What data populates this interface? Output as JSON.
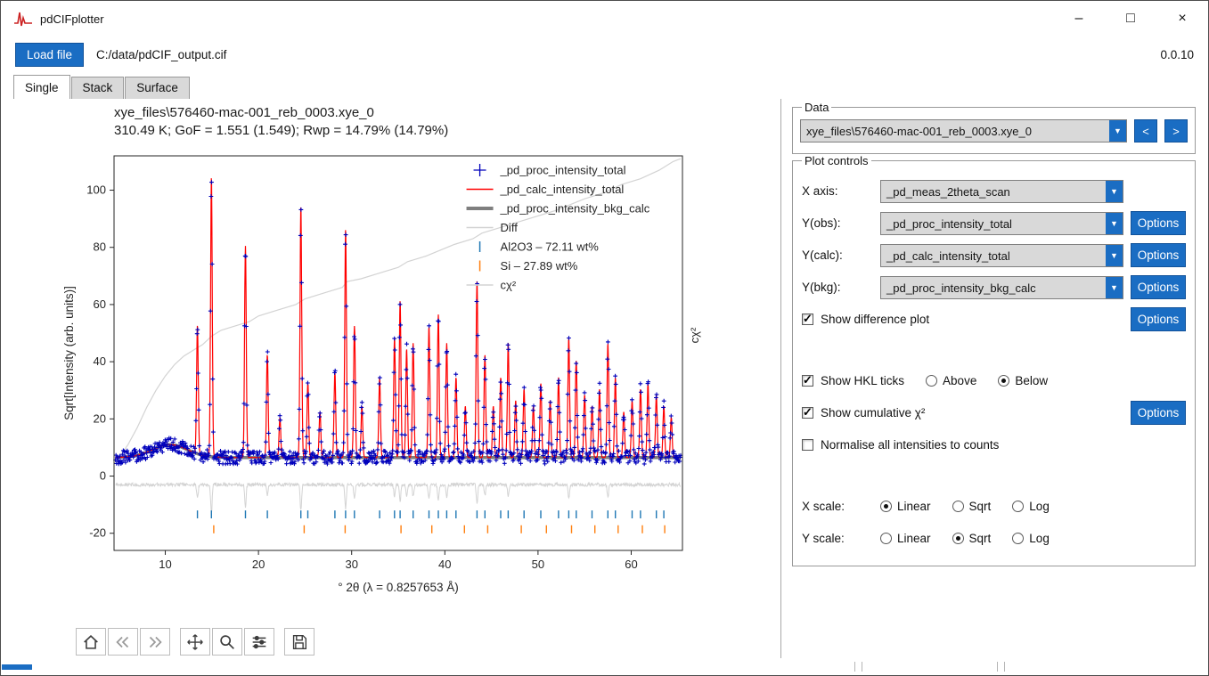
{
  "window": {
    "title": "pdCIFplotter",
    "controls": {
      "minimize": "–",
      "maximize": "□",
      "close": "×"
    }
  },
  "icons": {
    "dropdown": "▼"
  },
  "toolbar": {
    "load_file_label": "Load file",
    "file_path": "C:/data/pdCIF_output.cif",
    "version": "0.0.10"
  },
  "tabs": [
    {
      "label": "Single",
      "active": true
    },
    {
      "label": "Stack",
      "active": false
    },
    {
      "label": "Surface",
      "active": false
    }
  ],
  "data_section": {
    "label": "Data",
    "file_combo_value": "xye_files\\576460-mac-001_reb_0003.xye_0",
    "prev_label": "<",
    "next_label": ">"
  },
  "plot_controls": {
    "label": "Plot controls",
    "x_axis": {
      "label": "X axis:",
      "value": "_pd_meas_2theta_scan"
    },
    "y_obs": {
      "label": "Y(obs):",
      "value": "_pd_proc_intensity_total",
      "options_label": "Options"
    },
    "y_calc": {
      "label": "Y(calc):",
      "value": "_pd_calc_intensity_total",
      "options_label": "Options"
    },
    "y_bkg": {
      "label": "Y(bkg):",
      "value": "_pd_proc_intensity_bkg_calc",
      "options_label": "Options"
    },
    "show_difference": {
      "label": "Show difference plot",
      "checked": true,
      "options_label": "Options"
    },
    "show_hkl": {
      "label": "Show HKL ticks",
      "checked": true,
      "above_label": "Above",
      "below_label": "Below",
      "position": "Below"
    },
    "show_cumchi": {
      "label": "Show cumulative χ²",
      "checked": true,
      "options_label": "Options"
    },
    "normalise": {
      "label": "Normalise all intensities to counts",
      "checked": false
    },
    "x_scale": {
      "label": "X scale:",
      "options": [
        "Linear",
        "Sqrt",
        "Log"
      ],
      "selected": "Linear"
    },
    "y_scale": {
      "label": "Y scale:",
      "options": [
        "Linear",
        "Sqrt",
        "Log"
      ],
      "selected": "Sqrt"
    }
  },
  "nav_toolbar": {
    "icons": [
      "home",
      "back",
      "forward",
      "pan",
      "zoom",
      "configure-subplots",
      "save"
    ]
  },
  "colors": {
    "accent": "#1a6dc3",
    "obs": "#0000bb",
    "calc": "#ff0000",
    "bkg": "#7f7f7f",
    "diff": "#d3d3d3",
    "cumchi": "#d3d3d3",
    "al2o3": "#1f77b4",
    "si": "#ff7f0e",
    "axis": "#262626"
  },
  "chart_data": {
    "type": "scatter",
    "title_line1": "xye_files\\576460-mac-001_reb_0003.xye_0",
    "title_line2": "310.49 K; GoF = 1.551 (1.549); Rwp = 14.79% (14.79%)",
    "xlabel": "° 2θ (λ = 0.8257653 Å)",
    "ylabel": "Sqrt[Intensity (arb. units)]",
    "right_label": "cχ²",
    "xlim": [
      4.5,
      65.5
    ],
    "ylim": [
      -26,
      112
    ],
    "xticks": [
      10,
      20,
      30,
      40,
      50,
      60
    ],
    "yticks": [
      -20,
      0,
      20,
      40,
      60,
      80,
      100
    ],
    "legend": [
      {
        "label": "_pd_proc_intensity_total",
        "marker": "plus",
        "color": "#0000bb"
      },
      {
        "label": "_pd_calc_intensity_total",
        "marker": "line",
        "color": "#ff0000"
      },
      {
        "label": "_pd_proc_intensity_bkg_calc",
        "marker": "thickline",
        "color": "#7f7f7f"
      },
      {
        "label": "Diff",
        "marker": "line",
        "color": "#d3d3d3"
      },
      {
        "label": "Al2O3 – 72.11 wt%",
        "marker": "vtick",
        "color": "#1f77b4"
      },
      {
        "label": "Si – 27.89 wt%",
        "marker": "vtick",
        "color": "#ff7f0e"
      },
      {
        "label": "cχ²",
        "marker": "line",
        "color": "#d3d3d3"
      }
    ],
    "background": {
      "base": 6.5,
      "hump_center": 10.5,
      "hump_height": 4.5,
      "hump_width": 7
    },
    "peaks": [
      [
        13.45,
        45
      ],
      [
        14.95,
        98
      ],
      [
        18.6,
        74
      ],
      [
        20.95,
        36
      ],
      [
        22.3,
        14
      ],
      [
        24.55,
        88
      ],
      [
        25.3,
        26
      ],
      [
        26.6,
        16
      ],
      [
        28.2,
        30
      ],
      [
        29.35,
        80
      ],
      [
        30.3,
        46
      ],
      [
        31.1,
        18
      ],
      [
        33.0,
        28
      ],
      [
        34.6,
        42
      ],
      [
        35.2,
        55
      ],
      [
        35.9,
        38
      ],
      [
        36.6,
        40
      ],
      [
        38.3,
        46
      ],
      [
        39.3,
        50
      ],
      [
        40.2,
        40
      ],
      [
        41.2,
        28
      ],
      [
        42.2,
        18
      ],
      [
        43.45,
        62
      ],
      [
        44.3,
        36
      ],
      [
        45.2,
        18
      ],
      [
        46.0,
        28
      ],
      [
        46.8,
        40
      ],
      [
        47.6,
        20
      ],
      [
        48.5,
        24
      ],
      [
        49.5,
        18
      ],
      [
        50.3,
        26
      ],
      [
        51.3,
        20
      ],
      [
        52.2,
        28
      ],
      [
        53.3,
        42
      ],
      [
        54.1,
        34
      ],
      [
        55.0,
        22
      ],
      [
        55.8,
        18
      ],
      [
        56.6,
        24
      ],
      [
        57.5,
        40
      ],
      [
        58.3,
        28
      ],
      [
        59.2,
        16
      ],
      [
        60.1,
        20
      ],
      [
        61.0,
        24
      ],
      [
        61.8,
        26
      ],
      [
        62.7,
        22
      ],
      [
        63.5,
        18
      ],
      [
        64.3,
        14
      ]
    ],
    "hkl_al2o3": [
      13.45,
      14.95,
      18.6,
      20.95,
      24.55,
      25.3,
      28.2,
      29.35,
      30.3,
      33.0,
      34.6,
      35.2,
      36.6,
      38.3,
      39.3,
      40.2,
      41.2,
      43.45,
      44.3,
      46.0,
      46.8,
      48.5,
      50.3,
      52.2,
      53.3,
      54.1,
      55.8,
      57.5,
      58.3,
      60.1,
      61.0,
      62.7,
      63.5
    ],
    "hkl_si": [
      15.2,
      24.9,
      29.3,
      35.3,
      38.6,
      42.1,
      44.6,
      48.2,
      50.9,
      53.6,
      56.1,
      58.6,
      61.2,
      63.6
    ],
    "diff_baseline": -3,
    "cumchi_points": [
      [
        4.7,
        5
      ],
      [
        6,
        11
      ],
      [
        7,
        17
      ],
      [
        8,
        24
      ],
      [
        9,
        30
      ],
      [
        10,
        35
      ],
      [
        11,
        39
      ],
      [
        12,
        42
      ],
      [
        13,
        44
      ],
      [
        14,
        46
      ],
      [
        15,
        49
      ],
      [
        16,
        51
      ],
      [
        17,
        52
      ],
      [
        19,
        54
      ],
      [
        20,
        56
      ],
      [
        22,
        58
      ],
      [
        24,
        60
      ],
      [
        25,
        62
      ],
      [
        27,
        64
      ],
      [
        29,
        66
      ],
      [
        29.5,
        68
      ],
      [
        31,
        69
      ],
      [
        33,
        71
      ],
      [
        35,
        73
      ],
      [
        36,
        75
      ],
      [
        38,
        77
      ],
      [
        39.5,
        79
      ],
      [
        41,
        81
      ],
      [
        43,
        83
      ],
      [
        44,
        85
      ],
      [
        46,
        87
      ],
      [
        48,
        89
      ],
      [
        50,
        91
      ],
      [
        52,
        93
      ],
      [
        53.5,
        95
      ],
      [
        55,
        97
      ],
      [
        57,
        99
      ],
      [
        59,
        102
      ],
      [
        61,
        104
      ],
      [
        63,
        107
      ],
      [
        64.5,
        110
      ],
      [
        65.3,
        111
      ]
    ]
  }
}
